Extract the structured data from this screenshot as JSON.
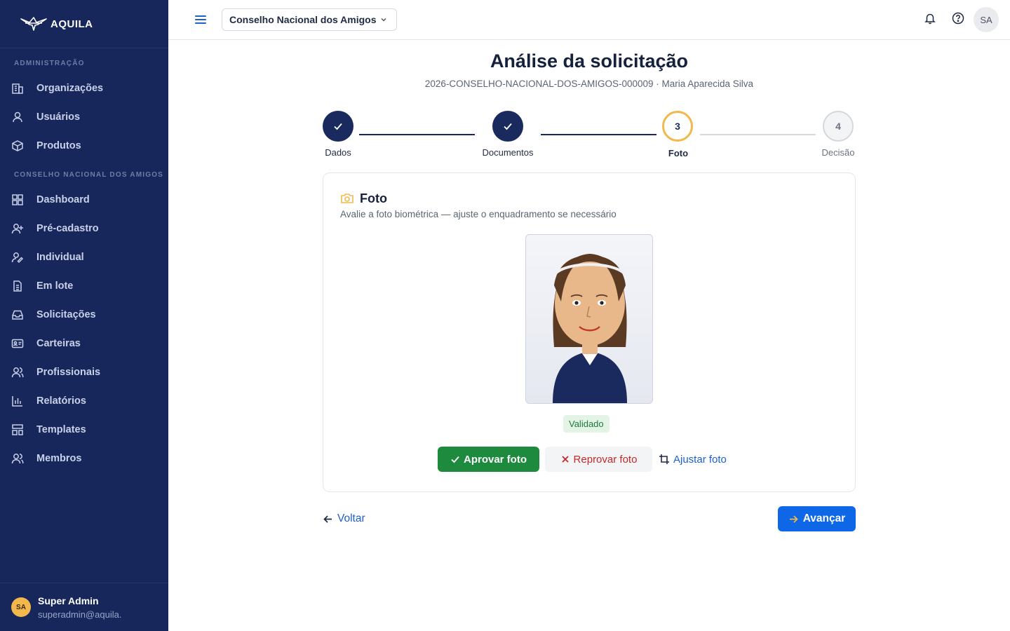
{
  "app": {
    "brand": "AQUILA"
  },
  "sidebar": {
    "section_admin": "ADMINISTRAÇÃO",
    "section_org": "CONSELHO NACIONAL DOS AMIGOS",
    "admin_items": [
      {
        "label": "Organizações",
        "icon": "building-icon"
      },
      {
        "label": "Usuários",
        "icon": "user-icon"
      },
      {
        "label": "Produtos",
        "icon": "box-icon"
      }
    ],
    "org_items": [
      {
        "label": "Dashboard",
        "icon": "dashboard-icon"
      },
      {
        "label": "Pré-cadastro",
        "icon": "user-plus-icon"
      },
      {
        "label": "Individual",
        "icon": "user-pen-icon"
      },
      {
        "label": "Em lote",
        "icon": "file-list-icon"
      },
      {
        "label": "Solicitações",
        "icon": "inbox-icon"
      },
      {
        "label": "Carteiras",
        "icon": "id-card-icon"
      },
      {
        "label": "Profissionais",
        "icon": "users-icon"
      },
      {
        "label": "Relatórios",
        "icon": "bar-chart-icon"
      },
      {
        "label": "Templates",
        "icon": "template-icon"
      },
      {
        "label": "Membros",
        "icon": "members-icon"
      }
    ],
    "user": {
      "initials": "SA",
      "name": "Super Admin",
      "email": "superadmin@aquila."
    }
  },
  "topbar": {
    "org_name": "Conselho Nacional dos Amigos",
    "avatar_initials": "SA"
  },
  "page": {
    "title": "Análise da solicitação",
    "subtitle": "2026-CONSELHO-NACIONAL-DOS-AMIGOS-000009 · Maria Aparecida Silva"
  },
  "stepper": {
    "steps": [
      {
        "label": "Dados",
        "state": "done",
        "number": "1"
      },
      {
        "label": "Documentos",
        "state": "done",
        "number": "2"
      },
      {
        "label": "Foto",
        "state": "current",
        "number": "3"
      },
      {
        "label": "Decisão",
        "state": "todo",
        "number": "4"
      }
    ]
  },
  "card": {
    "title": "Foto",
    "description": "Avalie a foto biométrica — ajuste o enquadramento se necessário",
    "status_badge": "Validado",
    "approve_label": "Aprovar foto",
    "reject_label": "Reprovar foto",
    "adjust_label": "Ajustar foto"
  },
  "footer": {
    "back_label": "Voltar",
    "next_label": "Avançar"
  },
  "colors": {
    "sidebar_bg": "#17275b",
    "step_done": "#1b2a5e",
    "step_current": "#f2b84b",
    "approve": "#1e8a3e",
    "reject": "#c62828",
    "link": "#1d5fcc",
    "primary": "#0d67e6"
  }
}
